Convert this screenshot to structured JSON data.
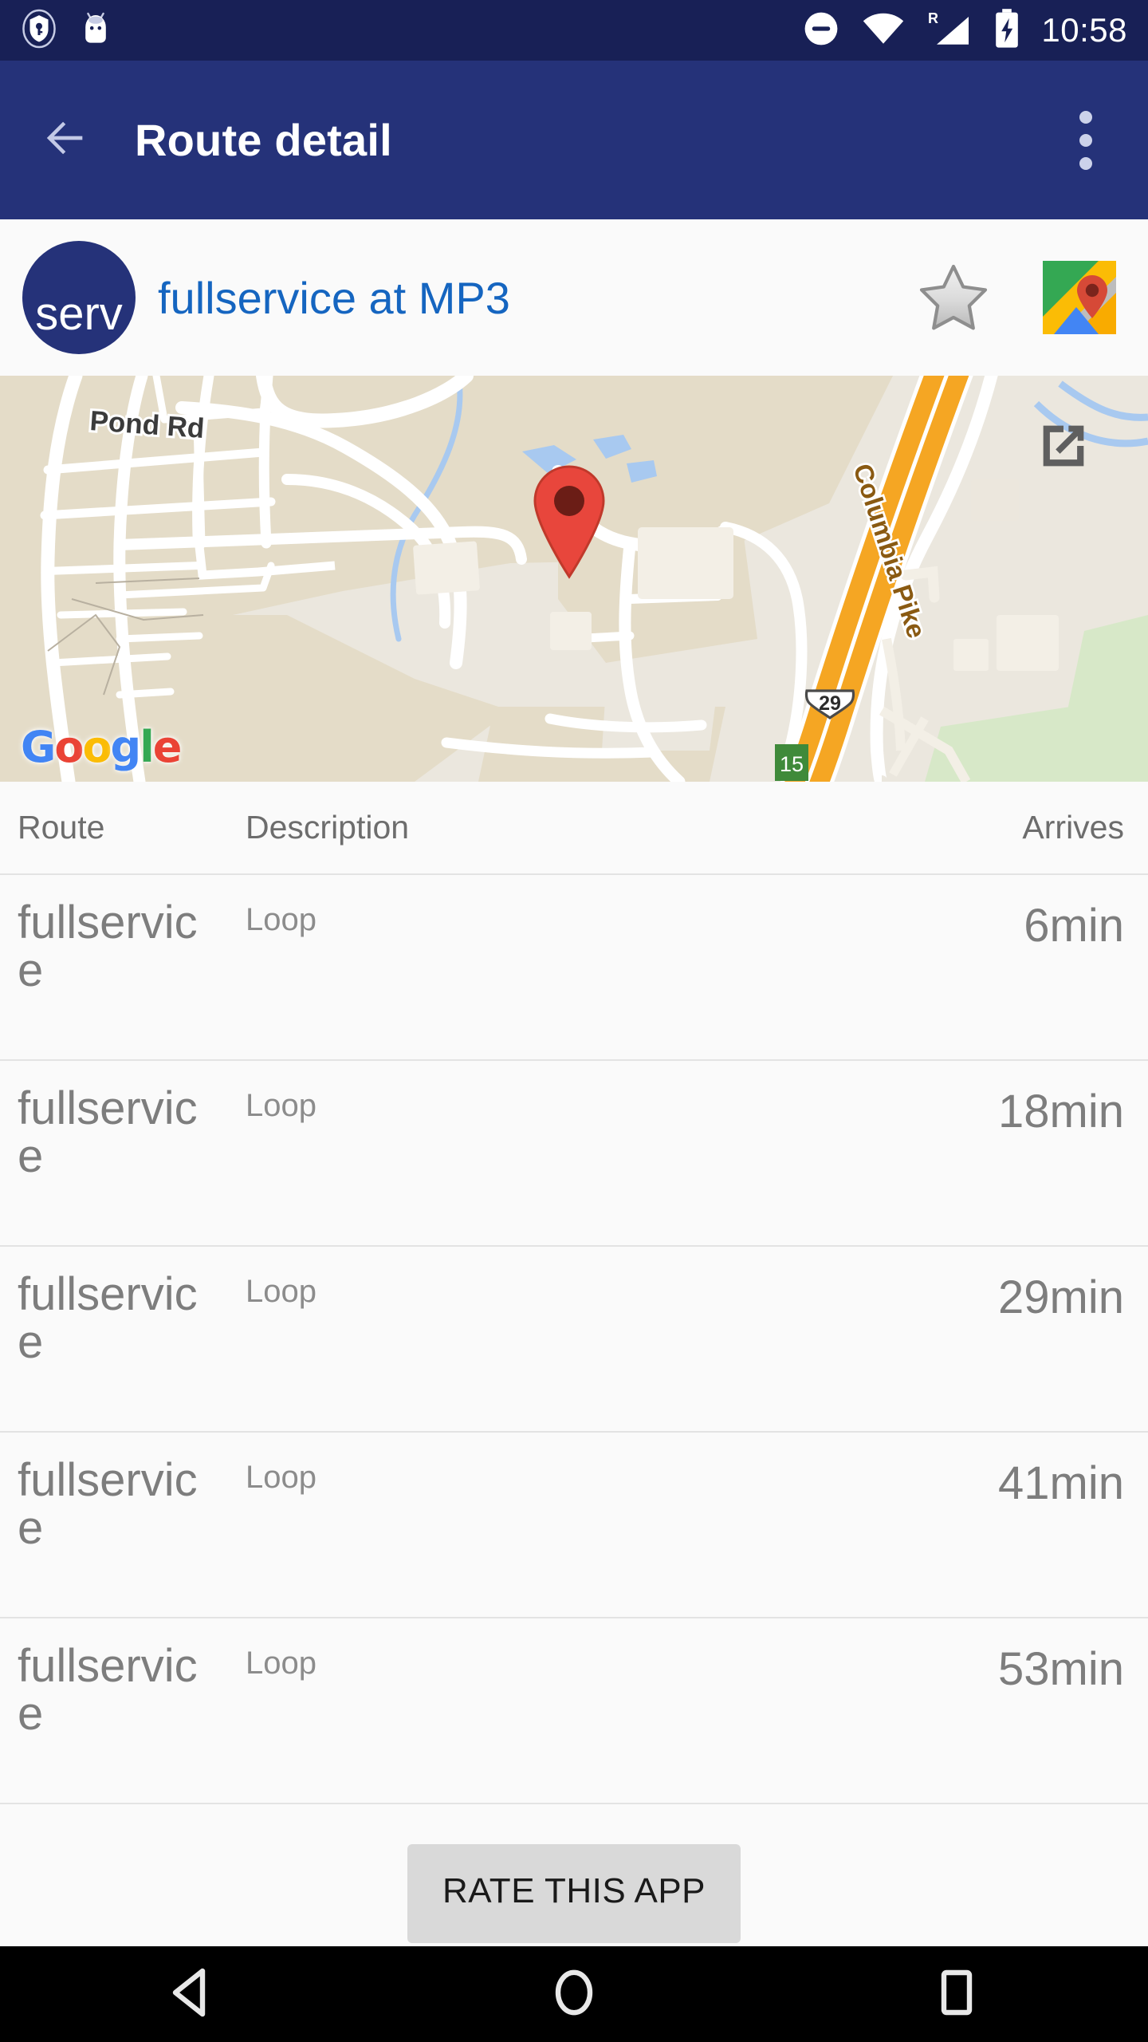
{
  "statusbar": {
    "time": "10:58",
    "icons": [
      "vpn-key-shield-icon",
      "android-robot-icon",
      "do-not-disturb-icon",
      "wifi-icon",
      "signal-roaming-icon",
      "battery-charging-icon"
    ],
    "roaming_label": "R",
    "background": "#182056"
  },
  "toolbar": {
    "back_label": "back-arrow",
    "title": "Route detail",
    "overflow_label": "more-options",
    "background": "#253279",
    "title_color": "#ffffff"
  },
  "stop_header": {
    "avatar_text": "serv",
    "avatar_color": "#253279",
    "title": "fullservice at MP3",
    "title_color": "#1565c0",
    "favorite_label": "favorite-star",
    "favorite_state": "off",
    "maps_label": "open-in-google-maps"
  },
  "map": {
    "labels": {
      "pond_rd": "Pond Rd",
      "columbia_pike": "Columbia Pike",
      "shield_29": "29",
      "exit_15": "15"
    },
    "brand": {
      "g1": "G",
      "o1": "o",
      "o2": "o",
      "g2": "g",
      "l": "l",
      "e": "e"
    },
    "brand_colors": {
      "blue": "#4285F4",
      "red": "#EA4335",
      "yellow": "#FBBC05",
      "green": "#34A853"
    },
    "expand_label": "open-external-map",
    "marker_label": "stop-location-marker",
    "colors": {
      "land": "#ebe7de",
      "built": "#e4dcc8",
      "park": "#d7e8c8",
      "road": "#ffffff",
      "highway": "#f5a623",
      "water": "#a8c9f0"
    }
  },
  "table": {
    "headers": {
      "route": "Route",
      "description": "Description",
      "arrives": "Arrives"
    },
    "rows": [
      {
        "route": "fullservice",
        "description": "Loop",
        "arrives": "6min"
      },
      {
        "route": "fullservice",
        "description": "Loop",
        "arrives": "18min"
      },
      {
        "route": "fullservice",
        "description": "Loop",
        "arrives": "29min"
      },
      {
        "route": "fullservice",
        "description": "Loop",
        "arrives": "41min"
      },
      {
        "route": "fullservice",
        "description": "Loop",
        "arrives": "53min"
      }
    ]
  },
  "footer": {
    "rate_button": "RATE THIS APP"
  },
  "navbar": {
    "back": "nav-back",
    "home": "nav-home",
    "recents": "nav-recents"
  }
}
